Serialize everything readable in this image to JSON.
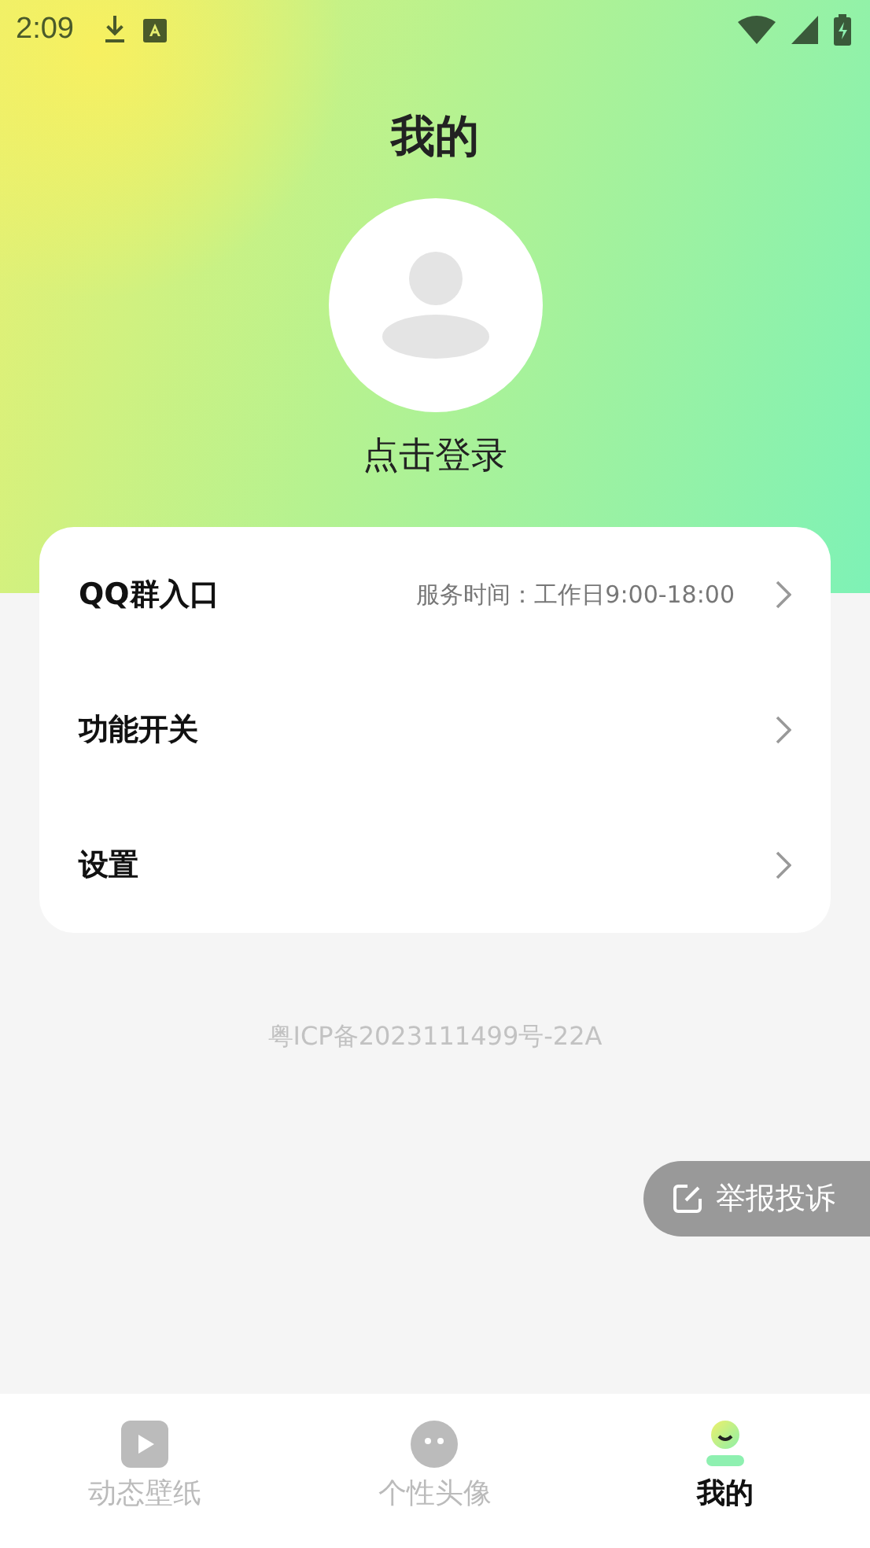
{
  "status_bar": {
    "time": "2:09"
  },
  "header": {
    "title": "我的",
    "login": "点击登录"
  },
  "menu": [
    {
      "label": "QQ群入口",
      "note": "服务时间：工作日9:00-18:00"
    },
    {
      "label": "功能开关"
    },
    {
      "label": "设置"
    }
  ],
  "icp": "粤ICP备2023111499号-22A",
  "report_button": "举报投诉",
  "tabs": [
    {
      "label": "动态壁纸",
      "kind": "video",
      "selected": false
    },
    {
      "label": "个性头像",
      "kind": "face",
      "selected": false
    },
    {
      "label": "我的",
      "kind": "person",
      "selected": true
    }
  ]
}
